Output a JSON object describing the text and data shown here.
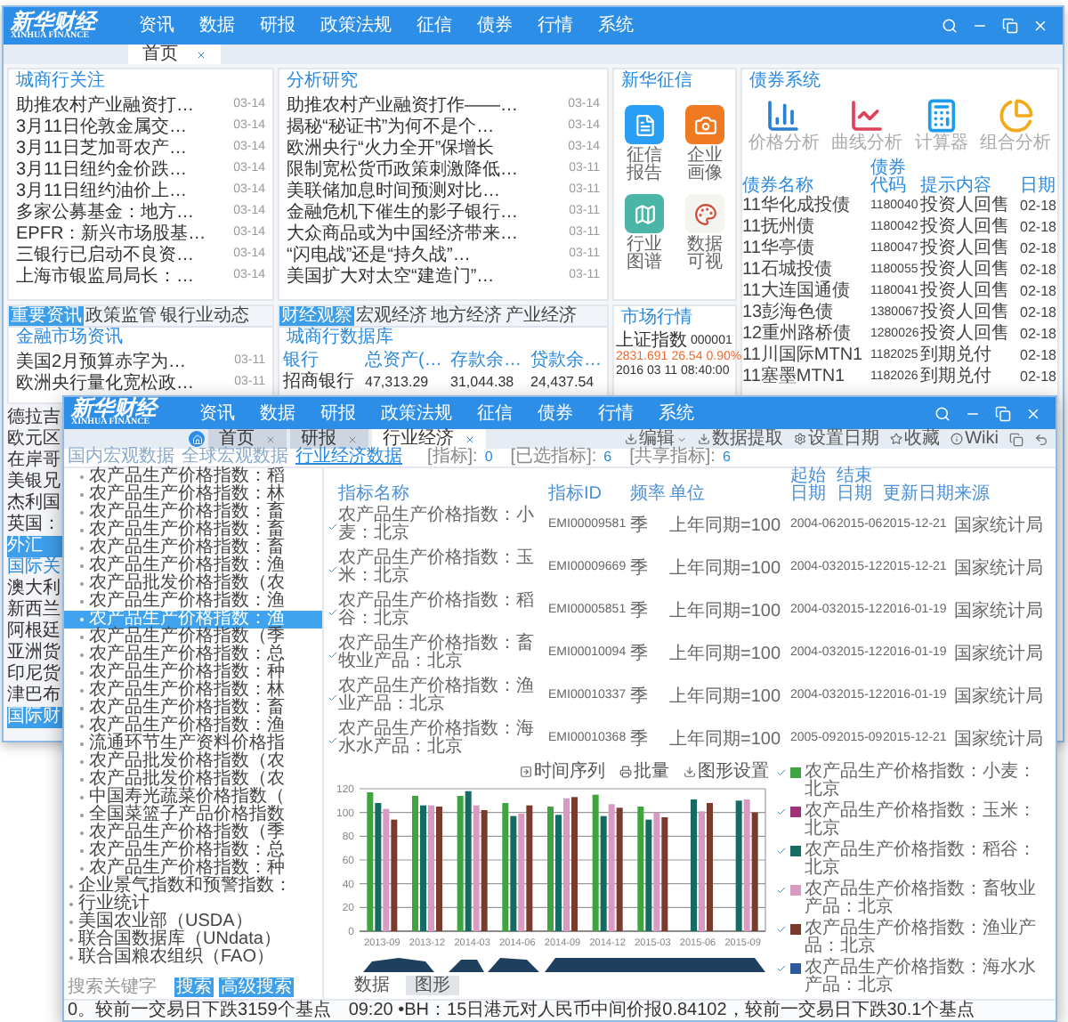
{
  "back_window": {
    "logo": {
      "name": "新华财经",
      "subtitle": "XINHUA FINANCE"
    },
    "menu": [
      "资讯",
      "数据",
      "研报",
      "政策法规",
      "征信",
      "债券",
      "行情",
      "系统"
    ],
    "tabs": [
      {
        "label": "首页",
        "selected": true
      }
    ],
    "focus": {
      "title": "城商行关注",
      "rows": [
        {
          "text": "助推农村产业融资打…",
          "time": "03-14"
        },
        {
          "text": "3月11日伦敦金属交…",
          "time": "03-14"
        },
        {
          "text": "3月11日芝加哥农产…",
          "time": "03-14"
        },
        {
          "text": "3月11日纽约金价跌…",
          "time": "03-14"
        },
        {
          "text": "3月11日纽约油价上…",
          "time": "03-14"
        },
        {
          "text": "多家公募基金：地方…",
          "time": "03-14"
        },
        {
          "text": "EPFR：新兴市场股基…",
          "time": "03-14"
        },
        {
          "text": "三银行已启动不良资…",
          "time": "03-14"
        },
        {
          "text": "上海市银监局局长：…",
          "time": "03-14"
        }
      ]
    },
    "research": {
      "title": "分析研究",
      "rows": [
        {
          "text": "助推农村产业融资打作——…",
          "time": "03-14"
        },
        {
          "text": "揭秘“秘证书”为何不是个…",
          "time": "03-14"
        },
        {
          "text": "欧洲央行“火力全开”保增长",
          "time": "03-14"
        },
        {
          "text": "限制宽松货币政策刺激降低…",
          "time": "03-11"
        },
        {
          "text": "美联储加息时间预测对比…",
          "time": "03-11"
        },
        {
          "text": "金融危机下催生的影子银行…",
          "time": "03-11"
        },
        {
          "text": "大众商品或为中国经济带来…",
          "time": "03-11"
        },
        {
          "text": "“闪电战”还是“持久战”…",
          "time": "03-11"
        },
        {
          "text": "美国扩大对太空“建造门”…",
          "time": "03-11"
        }
      ]
    },
    "credit": {
      "title": "新华征信",
      "apps": [
        {
          "label": "征信报告",
          "kind": "report"
        },
        {
          "label": "企业画像",
          "kind": "camera"
        },
        {
          "label": "行业图谱",
          "kind": "map"
        },
        {
          "label": "数据可视",
          "kind": "palette"
        }
      ]
    },
    "bonds": {
      "title": "债券系统",
      "tools": [
        {
          "label": "价格分析",
          "kind": "bar"
        },
        {
          "label": "曲线分析",
          "kind": "scatter"
        },
        {
          "label": "计算器",
          "kind": "calc"
        },
        {
          "label": "组合分析",
          "kind": "pie"
        }
      ],
      "columns": [
        "债券名称",
        "债券代码",
        "提示内容",
        "日期"
      ],
      "rows": [
        [
          "11华化成投债",
          "1180040",
          "投资人回售",
          "02-18"
        ],
        [
          "11抚州债",
          "1180042",
          "投资人回售",
          "02-18"
        ],
        [
          "11华亭债",
          "1180047",
          "投资人回售",
          "02-18"
        ],
        [
          "11石城投债",
          "1180055",
          "投资人回售",
          "02-18"
        ],
        [
          "11大连国通债",
          "1180041",
          "投资人回售",
          "02-18"
        ],
        [
          "13彭海色债",
          "1380067",
          "投资人回售",
          "02-18"
        ],
        [
          "12重州路桥债",
          "1280026",
          "投资人回售",
          "02-18"
        ],
        [
          "11川国际MTN1",
          "1182025",
          "到期兑付",
          "02-18"
        ],
        [
          "11塞墨MTN1",
          "1182026",
          "到期兑付",
          "02-18"
        ]
      ]
    },
    "news_tabs": [
      {
        "label": "重要资讯",
        "selected": true
      },
      {
        "label": "政策监管",
        "selected": false
      },
      {
        "label": "银行业动态",
        "selected": false
      }
    ],
    "market_news": {
      "title": "金融市场资讯",
      "rows": [
        {
          "text": "美国2月预算赤字为…",
          "time": "03-11"
        },
        {
          "text": "欧洲央行量化宽松政…",
          "time": "03-11"
        }
      ]
    },
    "watch_tabs": [
      {
        "label": "财经观察",
        "selected": true
      },
      {
        "label": "宏观经济",
        "selected": false
      },
      {
        "label": "地方经济",
        "selected": false
      },
      {
        "label": "产业经济",
        "selected": false
      }
    ],
    "bank_db": {
      "title": "城商行数据库",
      "columns": [
        "银行",
        "总资产(…",
        "存款余…",
        "贷款余…"
      ],
      "rows": [
        [
          "招商银行",
          "47,313.29",
          "31,044.38",
          "24,437.54"
        ]
      ]
    },
    "market": {
      "title": "市场行情",
      "index": "上证指数",
      "code": "000001",
      "price": "2831.691",
      "change": "26.54",
      "percent": "0.90%",
      "time": "2016 03 11 08:40:00"
    },
    "strip": [
      {
        "text": "德拉吉",
        "kind": "row"
      },
      {
        "text": "欧元区",
        "kind": "row"
      },
      {
        "text": "在岸哥",
        "kind": "row"
      },
      {
        "text": "美银兄",
        "kind": "row"
      },
      {
        "text": "杰利国",
        "kind": "row"
      },
      {
        "text": "英国：",
        "kind": "row"
      },
      {
        "text": "外汇",
        "kind": "tab"
      },
      {
        "text": "国际关",
        "kind": "heading"
      },
      {
        "text": "澳大利",
        "kind": "row"
      },
      {
        "text": "新西兰",
        "kind": "row"
      },
      {
        "text": "阿根廷",
        "kind": "row"
      },
      {
        "text": "亚洲货",
        "kind": "row"
      },
      {
        "text": "印尼货",
        "kind": "row"
      },
      {
        "text": "津巴布",
        "kind": "row"
      },
      {
        "text": "国际财",
        "kind": "tab"
      }
    ]
  },
  "front_window": {
    "logo": {
      "name": "新华财经",
      "subtitle": "XINHUA FINANCE"
    },
    "menu": [
      "资讯",
      "数据",
      "研报",
      "政策法规",
      "征信",
      "债券",
      "行情",
      "系统"
    ],
    "tabs": [
      {
        "label": "首页",
        "selected": false
      },
      {
        "label": "研报",
        "selected": false
      },
      {
        "label": "行业经济",
        "selected": true
      }
    ],
    "toolbar": [
      {
        "label": "编辑",
        "kind": "edit"
      },
      {
        "label": "数据提取",
        "kind": "extract"
      },
      {
        "label": "设置日期",
        "kind": "date"
      },
      {
        "label": "收藏",
        "kind": "star"
      },
      {
        "label": "Wiki",
        "kind": "info"
      }
    ],
    "subtabs": [
      {
        "label": "国内宏观数据",
        "selected": false
      },
      {
        "label": "全球宏观数据",
        "selected": false
      },
      {
        "label": "行业经济数据",
        "selected": true
      }
    ],
    "counts": [
      {
        "label": "[指标]:",
        "value": "0"
      },
      {
        "label": "[已选指标]:",
        "value": "6"
      },
      {
        "label": "[共享指标]:",
        "value": "6"
      }
    ],
    "tree": [
      {
        "children": [
          {
            "label": "农产品生产价格指数：稻",
            "selected": false
          },
          {
            "label": "农产品生产价格指数：林",
            "selected": false
          },
          {
            "label": "农产品生产价格指数：畜",
            "selected": false
          },
          {
            "label": "农产品生产价格指数：畜",
            "selected": false
          },
          {
            "label": "农产品生产价格指数：畜",
            "selected": false
          },
          {
            "label": "农产品生产价格指数：渔",
            "selected": false
          },
          {
            "label": "农产品批发价格指数（农",
            "selected": false
          },
          {
            "label": "农产品生产价格指数：渔",
            "selected": false
          },
          {
            "label": "农产品生产价格指数：渔",
            "selected": true
          },
          {
            "label": "农产品生产价格指数（季",
            "selected": false
          },
          {
            "label": "农产品生产价格指数：总",
            "selected": false
          },
          {
            "label": "农产品生产价格指数：种",
            "selected": false
          },
          {
            "label": "农产品生产价格指数：林",
            "selected": false
          },
          {
            "label": "农产品生产价格指数：畜",
            "selected": false
          },
          {
            "label": "农产品生产价格指数：渔",
            "selected": false
          },
          {
            "label": "流通环节生产资料价格指",
            "selected": false
          },
          {
            "label": "农产品批发价格指数（农",
            "selected": false
          },
          {
            "label": "农产品批发价格指数（农",
            "selected": false
          },
          {
            "label": "中国寿光蔬菜价格指数（",
            "selected": false
          },
          {
            "label": "全国菜篮子产品价格指数",
            "selected": false
          },
          {
            "label": "农产品生产价格指数（季",
            "selected": false
          },
          {
            "label": "农产品生产价格指数：总",
            "selected": false
          },
          {
            "label": "农产品生产价格指数：种",
            "selected": false
          }
        ]
      },
      {
        "label": "企业景气指数和预警指数：",
        "selected": false
      },
      {
        "label": "行业统计",
        "selected": false
      },
      {
        "label": "美国农业部（USDA）",
        "selected": false
      },
      {
        "label": "联合国数据库（UNdata）",
        "selected": false
      },
      {
        "label": "联合国粮农组织（FAO）",
        "selected": false
      }
    ],
    "search": {
      "placeholder": "搜索关键字",
      "buttons": [
        "搜索",
        "高级搜索"
      ]
    },
    "table": {
      "columns": [
        "指标名称",
        "指标ID",
        "频率",
        "单位",
        "起始日期",
        "结束日期",
        "更新日期",
        "来源"
      ],
      "rows": [
        {
          "checked": true,
          "cells": [
            "农产品生产价格指数：小麦：北京",
            "EMI00009581",
            "季",
            "上年同期=100",
            "2004-06",
            "2015-06",
            "2015-12-21",
            "国家统计局"
          ]
        },
        {
          "checked": true,
          "cells": [
            "农产品生产价格指数：玉米：北京",
            "EMI00009669",
            "季",
            "上年同期=100",
            "2004-03",
            "2015-12",
            "2015-12-21",
            "国家统计局"
          ]
        },
        {
          "checked": true,
          "cells": [
            "农产品生产价格指数：稻谷：北京",
            "EMI00005851",
            "季",
            "上年同期=100",
            "2004-03",
            "2015-12",
            "2016-01-19",
            "国家统计局"
          ]
        },
        {
          "checked": true,
          "cells": [
            "农产品生产价格指数：畜牧业产品：北京",
            "EMI00010094",
            "季",
            "上年同期=100",
            "2004-03",
            "2015-12",
            "2016-01-19",
            "国家统计局"
          ]
        },
        {
          "checked": true,
          "cells": [
            "农产品生产价格指数：渔业产品：北京",
            "EMI00010337",
            "季",
            "上年同期=100",
            "2004-03",
            "2015-12",
            "2016-01-19",
            "国家统计局"
          ]
        },
        {
          "checked": true,
          "cells": [
            "农产品生产价格指数：海水水产品：北京",
            "EMI00010368",
            "季",
            "上年同期=100",
            "2005-09",
            "2015-09",
            "2015-12-21",
            "国家统计局"
          ]
        }
      ]
    },
    "chart_tools": [
      {
        "label": "时间序列",
        "kind": "series"
      },
      {
        "label": "批量",
        "kind": "batch"
      },
      {
        "label": "图形设置",
        "kind": "settings"
      }
    ],
    "chart_data": {
      "type": "bar",
      "grid": true,
      "categories": [
        "2013-09",
        "2013-12",
        "2014-03",
        "2014-06",
        "2014-09",
        "2014-12",
        "2015-03",
        "2015-06",
        "2015-09"
      ],
      "ylim": [
        0,
        120
      ],
      "yticks": [
        0,
        20,
        40,
        60,
        80,
        100,
        120
      ],
      "series": [
        {
          "name": "农产品生产价格指数：小麦：北京",
          "color": "#3fa33f",
          "values": [
            117,
            114,
            114,
            108,
            105,
            115,
            105,
            null,
            null
          ]
        },
        {
          "name": "农产品生产价格指数：玉米：北京",
          "color": "#a03378",
          "values": [
            null,
            null,
            null,
            null,
            null,
            null,
            null,
            null,
            null
          ]
        },
        {
          "name": "农产品生产价格指数：稻谷：北京",
          "color": "#146b63",
          "values": [
            108,
            106,
            118,
            97,
            98,
            97,
            94,
            111,
            110
          ]
        },
        {
          "name": "农产品生产价格指数：畜牧业产品：北京",
          "color": "#d89ac0",
          "values": [
            103,
            106,
            106,
            99,
            112,
            107,
            100,
            101,
            111
          ]
        },
        {
          "name": "农产品生产价格指数：渔业产品：北京",
          "color": "#7b3b2c",
          "values": [
            94,
            105,
            102,
            106,
            113,
            104,
            96,
            108,
            100
          ]
        },
        {
          "name": "农产品生产价格指数：海水水产品：北京",
          "color": "#2c5b9b",
          "values": [
            null,
            null,
            null,
            null,
            null,
            null,
            null,
            null,
            null
          ]
        }
      ]
    },
    "view_tabs": [
      {
        "label": "数据",
        "selected": false
      },
      {
        "label": "图形",
        "selected": true
      }
    ],
    "ticker": [
      "0。较前一交易日下跌3159个基点",
      "09:20 •BH：15日港元对人民币中间价报0.84102，较前一交易日下跌30.1个基点"
    ]
  }
}
